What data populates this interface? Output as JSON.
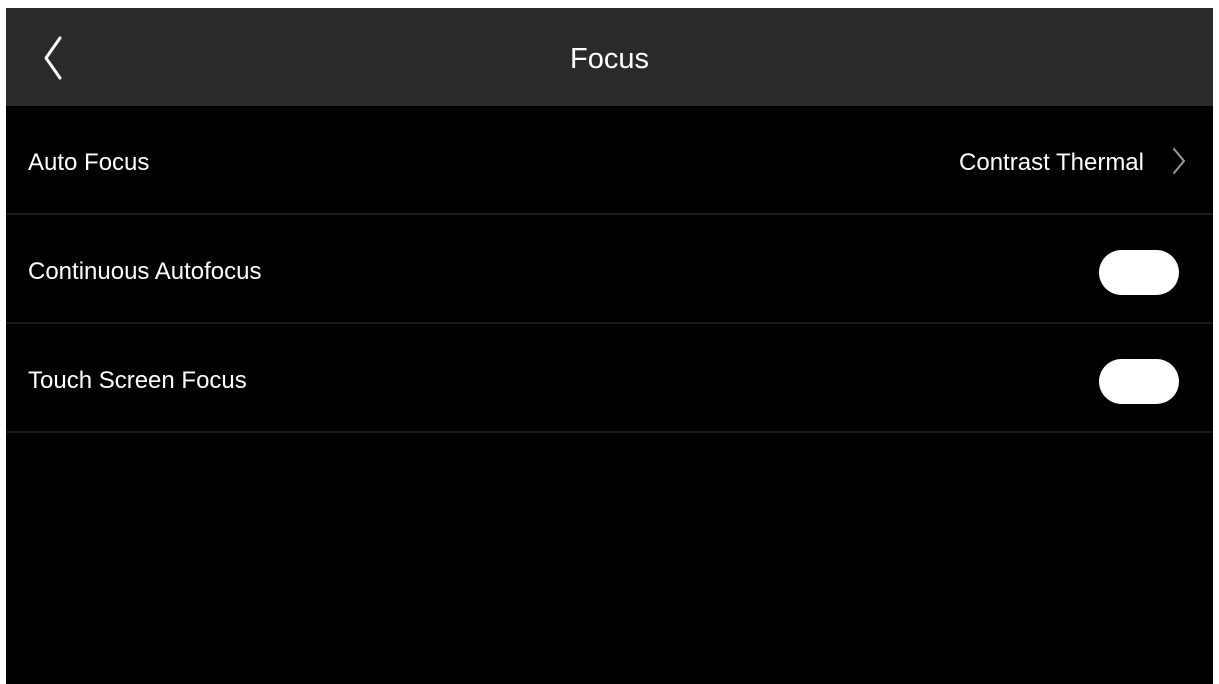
{
  "header": {
    "title": "Focus",
    "back_icon": "chevron-left-icon"
  },
  "settings": [
    {
      "label": "Auto Focus",
      "value": "Contrast Thermal",
      "control": "disclosure",
      "icon": "chevron-right-icon"
    },
    {
      "label": "Continuous Autofocus",
      "control": "toggle"
    },
    {
      "label": "Touch Screen Focus",
      "control": "toggle"
    }
  ],
  "colors": {
    "background": "#000000",
    "header_background": "#2a2a2a",
    "text": "#ffffff",
    "toggle": "#ffffff",
    "divider": "#1c1c1c"
  }
}
